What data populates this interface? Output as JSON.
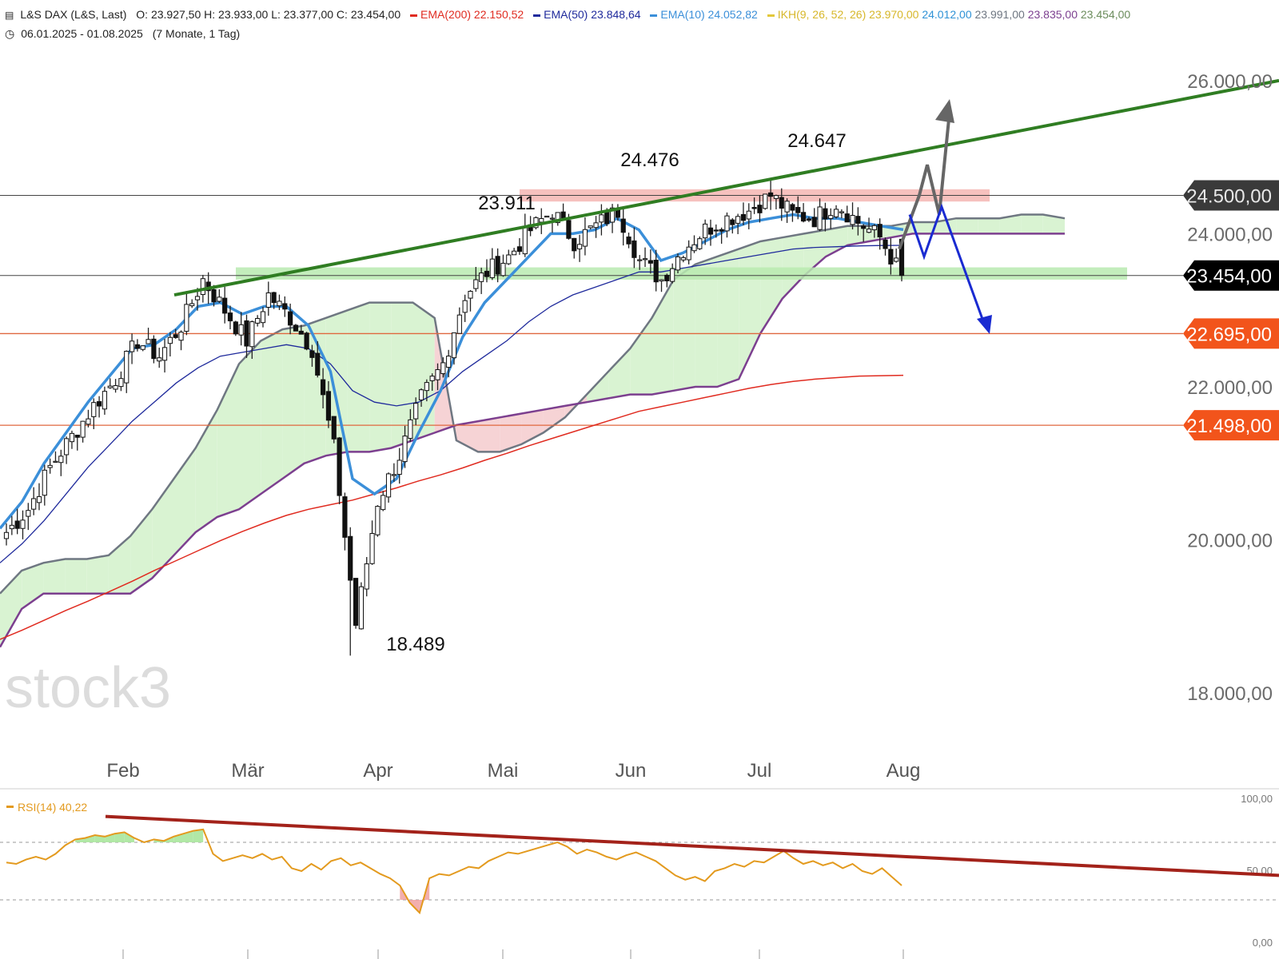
{
  "header": {
    "symbol": "L&S DAX (L&S, Last)",
    "ohlc": "O: 23.927,50  H: 23.933,00  L: 23.377,00  C: 23.454,00",
    "ema200_label": "EMA(200)",
    "ema200_value": "22.150,52",
    "ema50_label": "EMA(50)",
    "ema50_value": "23.848,64",
    "ema10_label": "EMA(10)",
    "ema10_value": "24.052,82",
    "ikh_label": "IKH(9, 26, 52, 26)",
    "ikh_values": [
      "23.970,00",
      "24.012,00",
      "23.991,00",
      "23.835,00",
      "23.454,00"
    ],
    "range": "06.01.2025 - 01.08.2025",
    "period": "(7 Monate, 1 Tag)"
  },
  "colors": {
    "ema200": "#e02b20",
    "ema50": "#1f2a9c",
    "ema10": "#3b8fd9",
    "ikh": "#e3c83b",
    "ikh_tenkan": "#2f92d6",
    "ikh_kijun": "#6f7782",
    "ikh_spanA": "#7c3f8f",
    "ikh_spanB": "#6b8c5c",
    "trend_green": "#2f7d22",
    "rsi": "#e39a1e",
    "rsi_trend": "#a3221a",
    "label_dark": "#3a3a3a",
    "label_black": "#000000",
    "label_orange": "#f2541b"
  },
  "watermark": "stock3",
  "chart_data": [
    {
      "type": "candlestick",
      "title": "L&S DAX (L&S, Last)",
      "x_range": [
        "06.01.2025",
        "01.08.2025"
      ],
      "ylim": [
        17500,
        26200
      ],
      "y_ticks": [
        {
          "value": 18000,
          "label": "18.000,00"
        },
        {
          "value": 20000,
          "label": "20.000,00"
        },
        {
          "value": 22000,
          "label": "22.000,00"
        },
        {
          "value": 24000,
          "label": "24.000,00"
        },
        {
          "value": 26000,
          "label": "26.000,00"
        }
      ],
      "month_ticks": [
        "Feb",
        "Mär",
        "Apr",
        "Mai",
        "Jun",
        "Jul",
        "Aug"
      ],
      "last_ohlc": {
        "open": 23927.5,
        "high": 23933,
        "low": 23377,
        "close": 23454
      },
      "key_points": [
        {
          "label": "23.911",
          "value": 23911,
          "date": "03.03.2025"
        },
        {
          "label": "24.476",
          "value": 24476,
          "date": "03.06.2025"
        },
        {
          "label": "24.647",
          "value": 24647,
          "date": "10.07.2025"
        },
        {
          "label": "18.489",
          "value": 18489,
          "date": "07.04.2025"
        }
      ],
      "price_labels": [
        {
          "label": "24.500,00",
          "value": 24500,
          "style": "dark"
        },
        {
          "label": "23.454,00",
          "value": 23454,
          "style": "black"
        },
        {
          "label": "22.695,00",
          "value": 22695,
          "style": "orange"
        },
        {
          "label": "21.498,00",
          "value": 21498,
          "style": "orange"
        }
      ],
      "horizontal_lines": [
        24500,
        23454,
        22695,
        21498
      ],
      "zones": [
        {
          "name": "resistance",
          "from": 24420,
          "to": 24580,
          "color": "#f4b6b3"
        },
        {
          "name": "support",
          "from": 23400,
          "to": 23560,
          "color": "#b8eab0"
        }
      ],
      "trendline": {
        "from": {
          "date": "17.02.2025",
          "value": 23200
        },
        "to": {
          "date": "end",
          "value": 26000
        }
      },
      "closes_weekly": [
        [
          20100,
          20400,
          20950,
          21350,
          21750,
          22100,
          22600,
          22400,
          22800,
          23400,
          23000,
          22600,
          23200,
          22900,
          22500,
          21200,
          18900,
          20500,
          21100,
          21850,
          22300,
          23200,
          23500,
          23700,
          24050,
          24300,
          23900,
          24100,
          24300,
          23650,
          23400,
          23800,
          24050,
          24200,
          24300,
          24500,
          24250,
          24200,
          24400,
          24150,
          23950,
          23454
        ]
      ],
      "ema10": [
        20150,
        20500,
        21000,
        21400,
        21800,
        22150,
        22500,
        22550,
        22750,
        23050,
        23100,
        22950,
        23050,
        23050,
        22800,
        22200,
        20800,
        20600,
        20800,
        21400,
        21950,
        22650,
        23100,
        23400,
        23700,
        24000,
        24000,
        24050,
        24200,
        24050,
        23650,
        23750,
        23900,
        24050,
        24150,
        24200,
        24250,
        24200,
        24200,
        24150,
        24100,
        24052
      ],
      "ema50": [
        19700,
        19950,
        20250,
        20600,
        20950,
        21250,
        21550,
        21800,
        22050,
        22250,
        22400,
        22450,
        22500,
        22550,
        22500,
        22300,
        21950,
        21800,
        21750,
        21800,
        21950,
        22200,
        22400,
        22600,
        22850,
        23050,
        23200,
        23300,
        23400,
        23500,
        23500,
        23550,
        23600,
        23650,
        23700,
        23750,
        23800,
        23820,
        23830,
        23840,
        23845,
        23848
      ],
      "ema200": [
        18700,
        18820,
        18950,
        19080,
        19200,
        19330,
        19460,
        19600,
        19730,
        19860,
        19990,
        20110,
        20220,
        20320,
        20400,
        20460,
        20520,
        20600,
        20680,
        20770,
        20850,
        20940,
        21040,
        21130,
        21230,
        21320,
        21410,
        21500,
        21590,
        21680,
        21740,
        21800,
        21860,
        21920,
        21980,
        22030,
        22070,
        22100,
        22120,
        22140,
        22145,
        22150
      ],
      "span_a": [
        19300,
        19600,
        19700,
        19750,
        19750,
        19800,
        20050,
        20400,
        20800,
        21200,
        21700,
        22300,
        22600,
        22750,
        22800,
        22900,
        23000,
        23100,
        23100,
        23100,
        22900,
        21300,
        21150,
        21150,
        21250,
        21400,
        21600,
        21900,
        22200,
        22500,
        22900,
        23400,
        23600,
        23700,
        23800,
        23900,
        23950,
        24000,
        24050,
        24100,
        24100,
        24100,
        24150,
        24150,
        24200,
        24200,
        24200,
        24250,
        24250,
        24200
      ],
      "span_b": [
        18600,
        19100,
        19300,
        19300,
        19300,
        19300,
        19300,
        19500,
        19800,
        20100,
        20300,
        20400,
        20600,
        20800,
        21000,
        21100,
        21150,
        21150,
        21200,
        21300,
        21400,
        21500,
        21550,
        21600,
        21650,
        21700,
        21750,
        21800,
        21850,
        21900,
        21900,
        21950,
        22000,
        22000,
        22100,
        22700,
        23150,
        23450,
        23700,
        23850,
        23900,
        23950,
        24000,
        24000,
        24000,
        24000,
        24000,
        24000,
        24000,
        24000
      ],
      "projection_up": [
        [
          23800,
          24500
        ],
        [
          24900,
          24250
        ],
        [
          24900,
          25600
        ]
      ],
      "projection_down": [
        [
          24250,
          23700,
          24350,
          22800
        ]
      ]
    },
    {
      "type": "line",
      "title": "RSI(14)",
      "last_value": "40,22",
      "ylim": [
        0,
        100
      ],
      "y_ticks": [
        {
          "value": 0,
          "label": "0,00"
        },
        {
          "value": 50,
          "label": "50,00"
        },
        {
          "value": 100,
          "label": "100,00"
        }
      ],
      "levels": [
        70,
        30
      ],
      "series": [
        {
          "name": "RSI(14)",
          "values": [
            56,
            55,
            58,
            60,
            58,
            62,
            68,
            72,
            73,
            75,
            74,
            76,
            77,
            73,
            70,
            72,
            71,
            74,
            76,
            78,
            79,
            62,
            57,
            59,
            61,
            59,
            62,
            58,
            60,
            52,
            50,
            55,
            51,
            57,
            59,
            54,
            56,
            52,
            48,
            45,
            40,
            28,
            21,
            45,
            48,
            47,
            50,
            53,
            52,
            57,
            60,
            63,
            62,
            64,
            66,
            68,
            70,
            67,
            62,
            65,
            63,
            60,
            58,
            61,
            63,
            60,
            57,
            52,
            47,
            44,
            46,
            43,
            50,
            52,
            55,
            53,
            57,
            56,
            60,
            64,
            59,
            55,
            57,
            54,
            56,
            52,
            55,
            50,
            48,
            52,
            46,
            40
          ]
        }
      ],
      "trendline": {
        "from": 88,
        "to": 47
      }
    }
  ]
}
